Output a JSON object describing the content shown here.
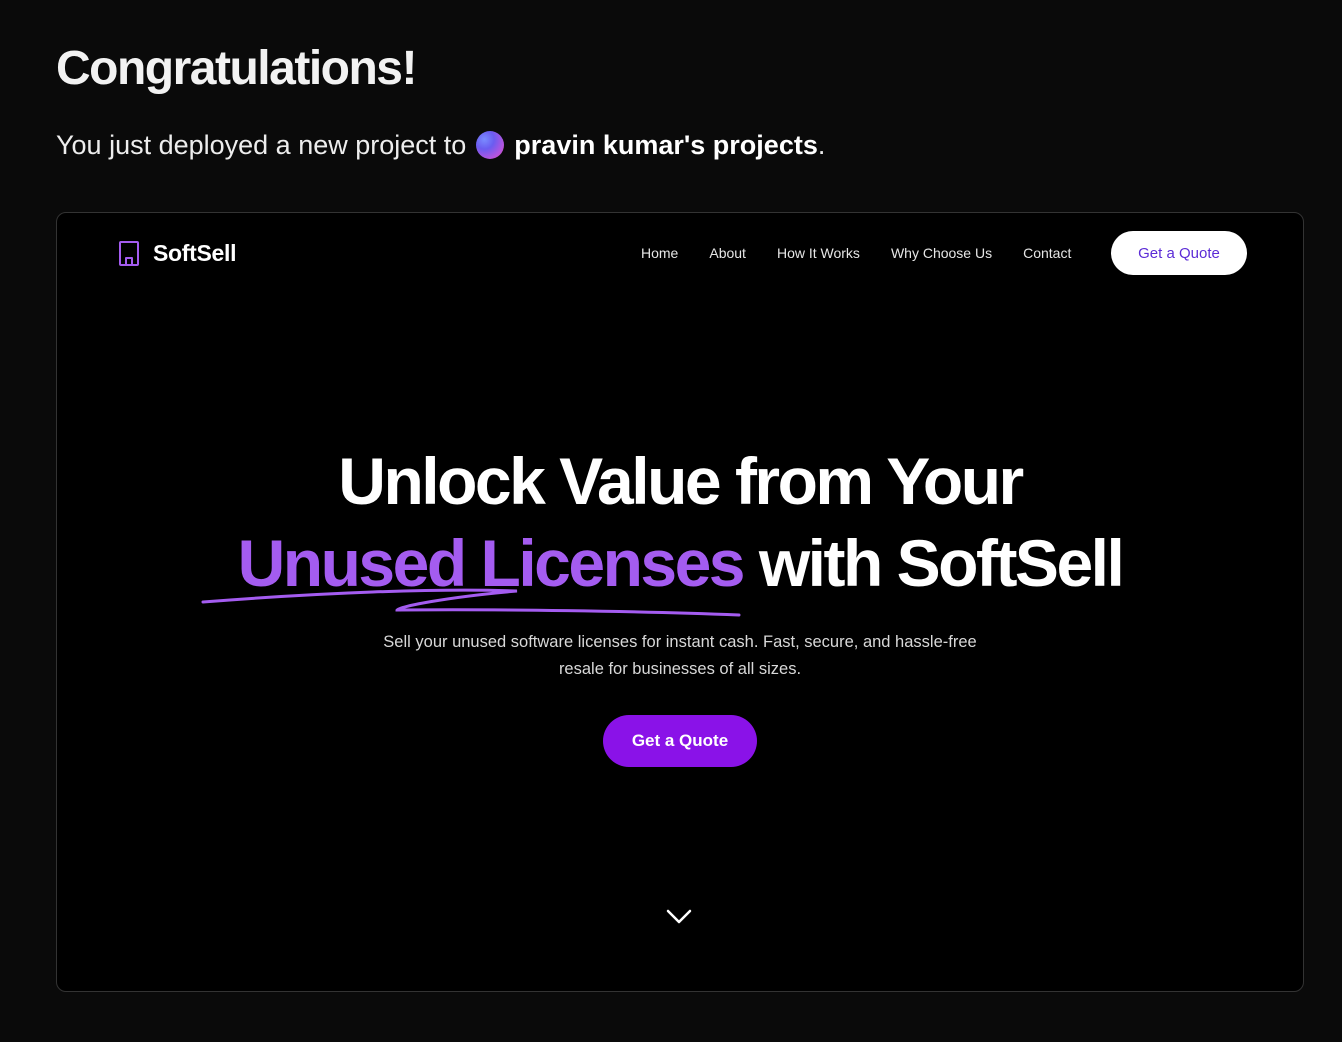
{
  "header": {
    "title": "Congratulations!",
    "message_prefix": "You just deployed a new project to",
    "team_name": "pravin kumar's projects",
    "message_suffix": "."
  },
  "preview": {
    "brand": {
      "name": "SoftSell",
      "icon": "building-icon"
    },
    "nav": {
      "links": [
        "Home",
        "About",
        "How It Works",
        "Why Choose Us",
        "Contact"
      ],
      "cta_label": "Get a Quote"
    },
    "hero": {
      "headline_line1": "Unlock Value from Your",
      "headline_accent": "Unused Licenses",
      "headline_rest": " with SoftSell",
      "description_line1": "Sell your unused software licenses for instant cash. Fast, secure, and hassle-free",
      "description_line2": "resale for businesses of all sizes.",
      "cta_label": "Get a Quote",
      "scroll_icon": "chevron-down-icon"
    },
    "colors": {
      "accent": "#a45cf0",
      "cta_background": "#8a12e8",
      "nav_cta_text": "#5b2bd6",
      "background": "#000000"
    }
  }
}
